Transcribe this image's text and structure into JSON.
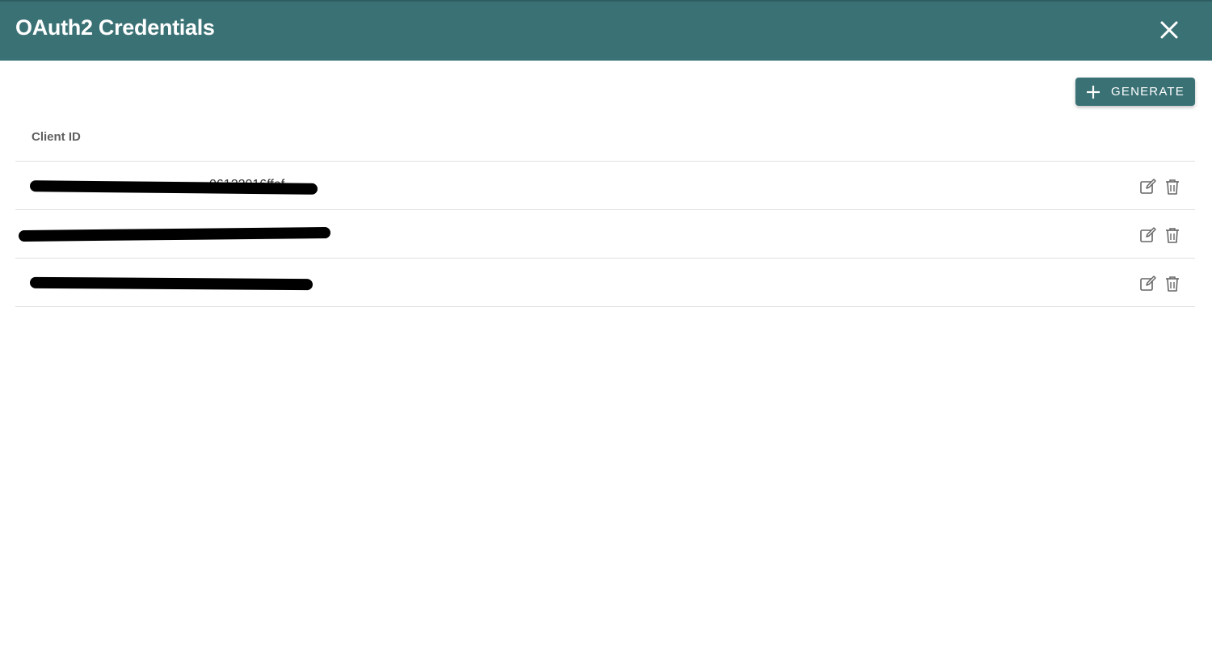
{
  "header": {
    "title": "OAuth2 Credentials",
    "close_icon": "close-icon",
    "background": "#3a7175"
  },
  "toolbar": {
    "generate_label": "GENERATE",
    "generate_icon": "plus-icon"
  },
  "table": {
    "columns": [
      "Client ID"
    ],
    "rows": [
      {
        "client_id": "06122016ffef",
        "redacted": true
      },
      {
        "client_id": "",
        "redacted": true
      },
      {
        "client_id": "",
        "redacted": true
      }
    ],
    "row_actions": [
      "edit-icon",
      "trash-icon"
    ]
  }
}
